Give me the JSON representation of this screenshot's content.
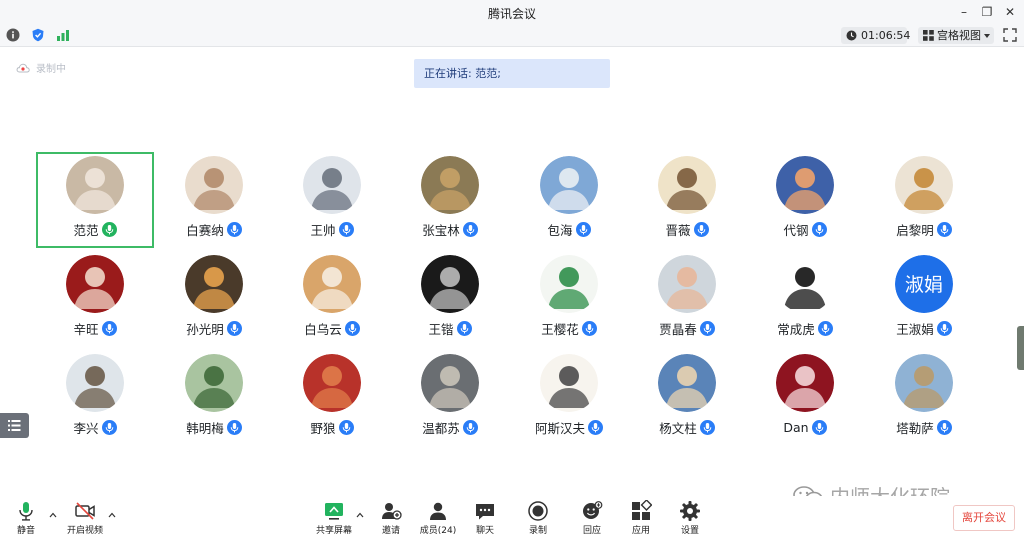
{
  "window": {
    "title": "腾讯会议"
  },
  "toolbar": {
    "timer": "01:06:54",
    "view_mode": "宫格视图"
  },
  "status": {
    "recording_label": "录制中",
    "speaking_text": "正在讲话: 范范;"
  },
  "participants": [
    {
      "name": "范范",
      "mic": "green",
      "active": true,
      "bg": "#c9b9a5",
      "fg": "#efe6dc"
    },
    {
      "name": "白赛纳",
      "mic": "blue",
      "active": false,
      "bg": "#e9dccd",
      "fg": "#b28b6c"
    },
    {
      "name": "王帅",
      "mic": "blue",
      "active": false,
      "bg": "#dfe4ea",
      "fg": "#6b7380"
    },
    {
      "name": "张宝林",
      "mic": "blue",
      "active": false,
      "bg": "#8b7a55",
      "fg": "#c7a267"
    },
    {
      "name": "包海",
      "mic": "blue",
      "active": false,
      "bg": "#7fa8d6",
      "fg": "#e9eef3"
    },
    {
      "name": "晋薇",
      "mic": "blue",
      "active": false,
      "bg": "#efe3c8",
      "fg": "#7a5a3a"
    },
    {
      "name": "代钢",
      "mic": "blue",
      "active": false,
      "bg": "#3e61a8",
      "fg": "#f0a36a"
    },
    {
      "name": "启黎明",
      "mic": "blue",
      "active": false,
      "bg": "#ece3d4",
      "fg": "#c58a3a"
    },
    {
      "name": "辛旺",
      "mic": "blue",
      "active": false,
      "bg": "#9a1b1b",
      "fg": "#f1d7c8"
    },
    {
      "name": "孙光明",
      "mic": "blue",
      "active": false,
      "bg": "#4a3a2a",
      "fg": "#e8a34d"
    },
    {
      "name": "白乌云",
      "mic": "blue",
      "active": false,
      "bg": "#d9a56a",
      "fg": "#f5ecdf"
    },
    {
      "name": "王锴",
      "mic": "blue",
      "active": false,
      "bg": "#1a1a1a",
      "fg": "#bdbdbd"
    },
    {
      "name": "王樱花",
      "mic": "blue",
      "active": false,
      "bg": "#f3f6f2",
      "fg": "#2f8f4a"
    },
    {
      "name": "贾晶春",
      "mic": "blue",
      "active": false,
      "bg": "#cfd6dc",
      "fg": "#e7b79a"
    },
    {
      "name": "常成虎",
      "mic": "blue",
      "active": false,
      "bg": "#ffffff",
      "fg": "#111111"
    },
    {
      "name": "王淑娟",
      "mic": "blue",
      "active": false,
      "bg": "#1e6fe8",
      "fg": "#ffffff",
      "initials": "淑娟"
    },
    {
      "name": "李兴",
      "mic": "blue",
      "active": false,
      "bg": "#dfe5ea",
      "fg": "#6a5b4a"
    },
    {
      "name": "韩明梅",
      "mic": "blue",
      "active": false,
      "bg": "#a9c4a0",
      "fg": "#3f6a3a"
    },
    {
      "name": "野狼",
      "mic": "blue",
      "active": false,
      "bg": "#b8322a",
      "fg": "#e07b4a"
    },
    {
      "name": "温都苏",
      "mic": "blue",
      "active": false,
      "bg": "#6a6e72",
      "fg": "#c9c3b8"
    },
    {
      "name": "阿斯汉夫",
      "mic": "blue",
      "active": false,
      "bg": "#f7f4ee",
      "fg": "#4a4a4a"
    },
    {
      "name": "杨文柱",
      "mic": "blue",
      "active": false,
      "bg": "#5a84b8",
      "fg": "#e9d3b0"
    },
    {
      "name": "Dan",
      "mic": "blue",
      "active": false,
      "bg": "#8e1420",
      "fg": "#f4d6d8"
    },
    {
      "name": "塔勒萨",
      "mic": "blue",
      "active": false,
      "bg": "#8fb2d4",
      "fg": "#b99a6a"
    }
  ],
  "bottom_bar": {
    "mute": "静音",
    "video": "开启视频",
    "share": "共享屏幕",
    "invite": "邀请",
    "members": "成员(24)",
    "chat": "聊天",
    "record": "录制",
    "react": "回应",
    "apps": "应用",
    "settings": "设置",
    "leave": "离开会议"
  },
  "watermark": "内师大化环院",
  "colors": {
    "accent": "#2a7df7",
    "active_border": "#3dbb66",
    "leave_text": "#e4463c"
  }
}
